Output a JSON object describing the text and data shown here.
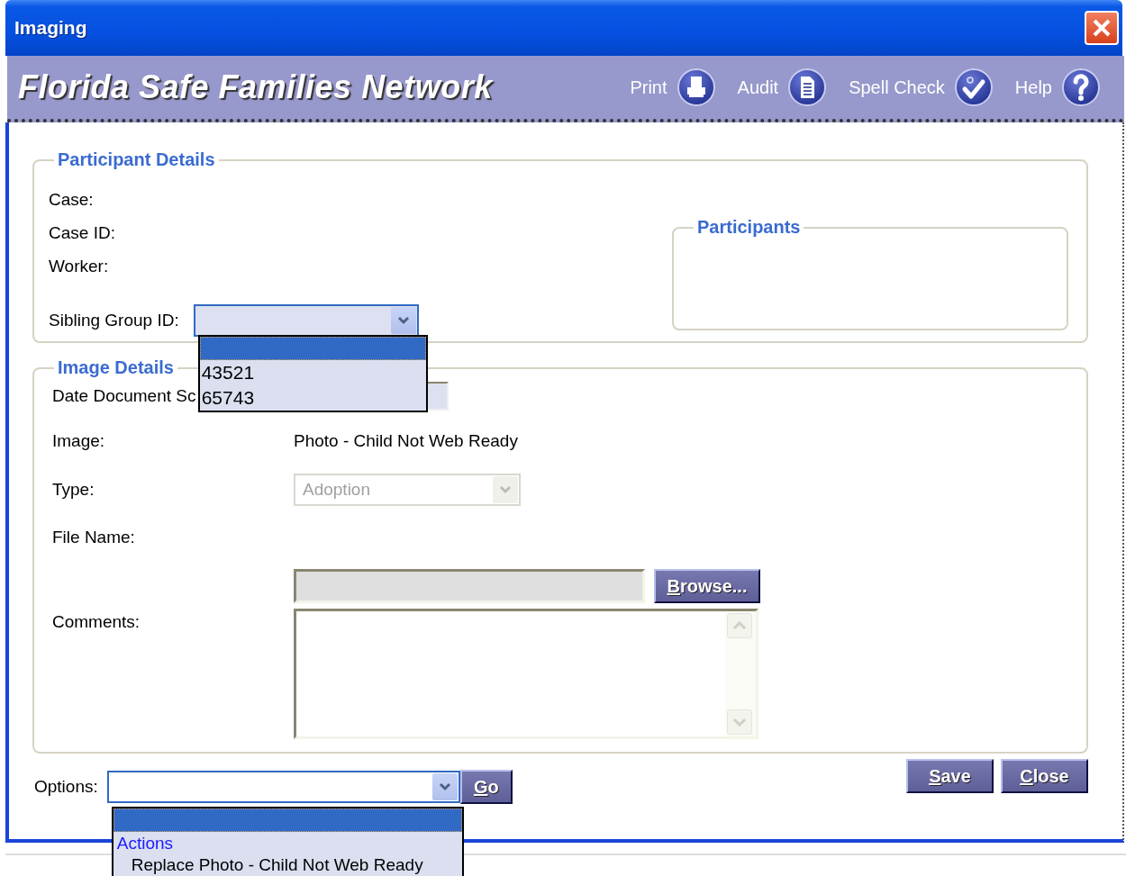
{
  "window": {
    "title": "Imaging"
  },
  "header": {
    "title": "Florida Safe Families Network",
    "tools": [
      {
        "label": "Print"
      },
      {
        "label": "Audit"
      },
      {
        "label": "Spell Check"
      },
      {
        "label": "Help"
      }
    ]
  },
  "participant_details": {
    "legend": "Participant Details",
    "fields": [
      {
        "label": "Case:"
      },
      {
        "label": "Case ID:"
      },
      {
        "label": "Worker:"
      }
    ],
    "sibling_group": {
      "label": "Sibling Group ID:",
      "expanded": true,
      "options": [
        "43521",
        "65743"
      ]
    },
    "participants": {
      "legend": "Participants"
    }
  },
  "image_details": {
    "legend": "Image Details",
    "date_label": "Date Document Sc",
    "image": {
      "label": "Image:",
      "value": "Photo - Child Not Web Ready"
    },
    "type": {
      "label": "Type:",
      "value": "Adoption",
      "disabled": true
    },
    "file_name": {
      "label": "File Name:",
      "browse": "Browse..."
    },
    "comments": {
      "label": "Comments:"
    }
  },
  "options": {
    "label": "Options:",
    "go": "Go",
    "expanded": true,
    "items": [
      {
        "kind": "group",
        "text": "Actions"
      },
      {
        "kind": "item",
        "text": "Replace Photo - Child Not Web Ready"
      }
    ]
  },
  "buttons": [
    "Save",
    "Close"
  ]
}
